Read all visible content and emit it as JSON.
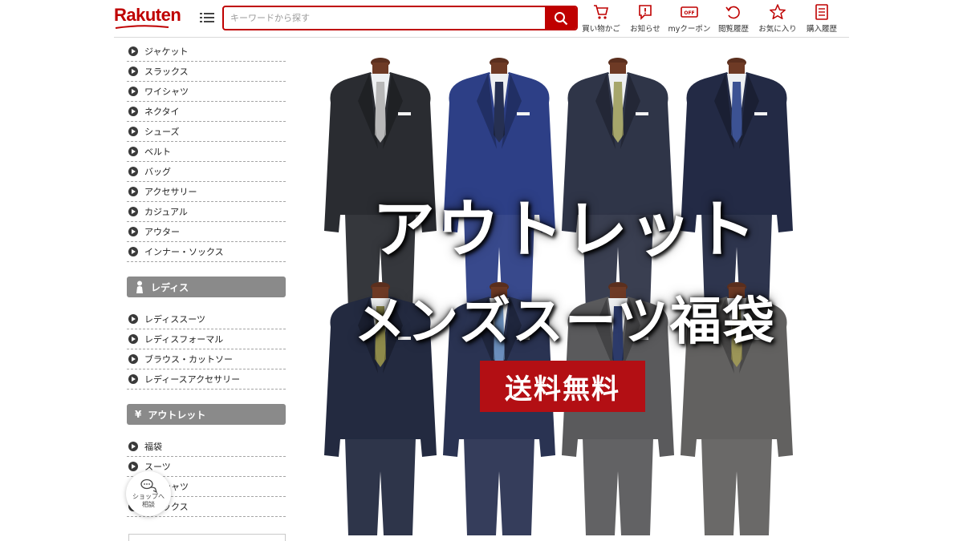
{
  "header": {
    "logo_text": "Rakuten",
    "brand_color": "#bf0000",
    "search": {
      "placeholder": "キーワードから探す",
      "value": ""
    },
    "nav": [
      {
        "label": "買い物かご",
        "icon": "cart-icon"
      },
      {
        "label": "お知らせ",
        "icon": "notice-icon"
      },
      {
        "label": "myクーポン",
        "icon": "coupon-icon",
        "icon_text": "OFF"
      },
      {
        "label": "閲覧履歴",
        "icon": "history-icon"
      },
      {
        "label": "お気に入り",
        "icon": "star-icon"
      },
      {
        "label": "購入履歴",
        "icon": "receipt-icon"
      }
    ]
  },
  "sidebar": {
    "mens_items": [
      {
        "label": "ジャケット"
      },
      {
        "label": "スラックス"
      },
      {
        "label": "ワイシャツ"
      },
      {
        "label": "ネクタイ"
      },
      {
        "label": "シューズ"
      },
      {
        "label": "ベルト"
      },
      {
        "label": "バッグ"
      },
      {
        "label": "アクセサリー"
      },
      {
        "label": "カジュアル"
      },
      {
        "label": "アウター"
      },
      {
        "label": "インナー・ソックス"
      }
    ],
    "ladies_heading": "レディス",
    "ladies_items": [
      {
        "label": "レディススーツ"
      },
      {
        "label": "レディスフォーマル"
      },
      {
        "label": "ブラウス・カットソー"
      },
      {
        "label": "レディースアクセサリー"
      }
    ],
    "outlet_heading": "アウトレット",
    "outlet_icon_text": "¥",
    "outlet_items": [
      {
        "label": "福袋"
      },
      {
        "label": "スーツ"
      },
      {
        "label": "ワイシャツ"
      },
      {
        "label": "スラックス"
      }
    ]
  },
  "chat": {
    "label": "ショップへ相談"
  },
  "banner": {
    "title_line1": "アウトレット",
    "title_line2": "メンズスーツ福袋",
    "badge": "送料無料",
    "badge_color": "#b30f14"
  }
}
